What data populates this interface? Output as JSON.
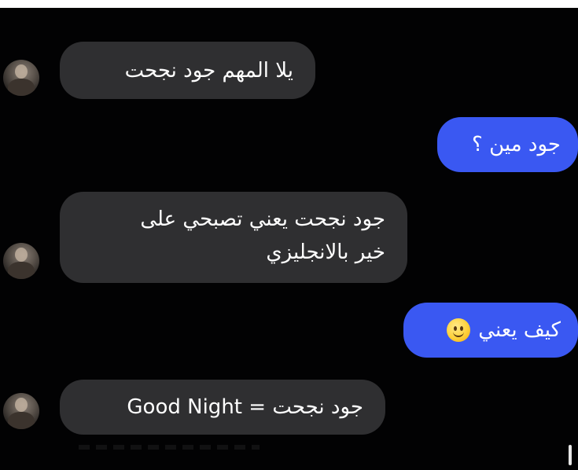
{
  "chat": {
    "messages": [
      {
        "direction": "incoming",
        "text": "يلا المهم جود نجحت"
      },
      {
        "direction": "outgoing",
        "text": "جود مين ؟"
      },
      {
        "direction": "incoming",
        "lines": [
          "جود نجحت يعني تصبحي على",
          "خير بالانجليزي"
        ]
      },
      {
        "direction": "outgoing",
        "text": "كيف يعني",
        "emoji": "slightly-smiling-face-icon"
      },
      {
        "direction": "incoming",
        "text": "جود نجحت = Good Night"
      }
    ]
  },
  "colors": {
    "background": "#020203",
    "incoming_bubble": "#2f2f31",
    "outgoing_bubble": "#3a58f2",
    "text": "#ffffff"
  }
}
